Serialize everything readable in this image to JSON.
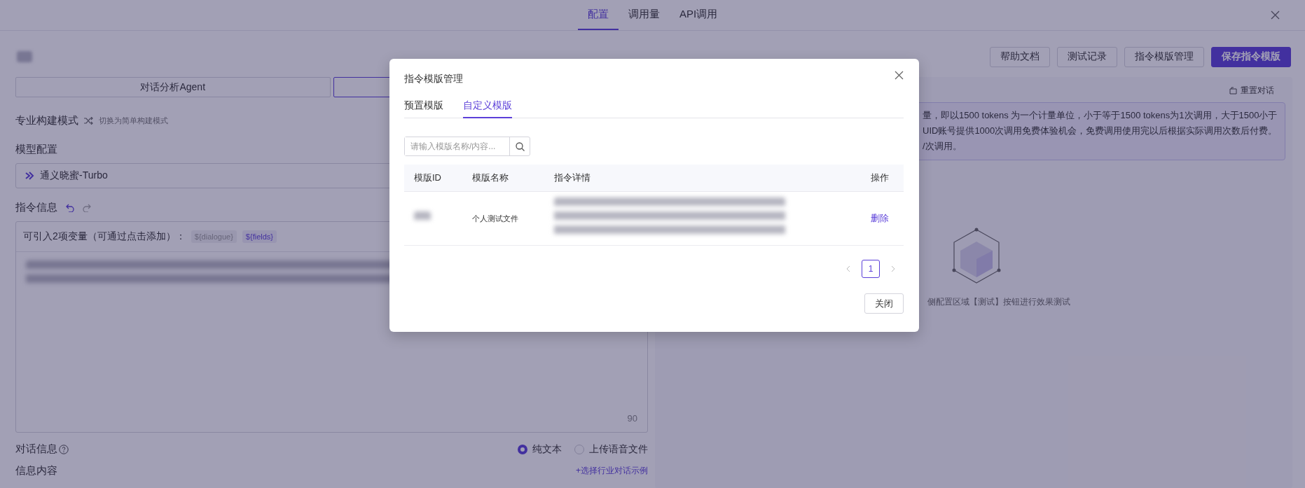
{
  "top_tabs": [
    {
      "label": "配置",
      "selected": true
    },
    {
      "label": "调用量",
      "selected": false
    },
    {
      "label": "API调用",
      "selected": false
    }
  ],
  "toolbar_buttons": [
    {
      "label": "帮助文档",
      "kind": "default"
    },
    {
      "label": "测试记录",
      "kind": "default"
    },
    {
      "label": "指令模版管理",
      "kind": "default"
    },
    {
      "label": "保存指令模版",
      "kind": "primary"
    }
  ],
  "agent_tabs": [
    {
      "label": "对话分析Agent",
      "selected": false
    },
    {
      "selected": true
    }
  ],
  "build_mode": {
    "label": "专业构建模式",
    "switch_link": "切换为简单构建模式"
  },
  "model_config": {
    "label": "模型配置",
    "value": "通义晓蜜-Turbo"
  },
  "instruction": {
    "label": "指令信息",
    "variables_hint": "可引入2项变量（可通过点击添加）：",
    "variables": [
      {
        "label": "${dialogue}",
        "disabled": true
      },
      {
        "label": "${fields}",
        "disabled": false
      }
    ],
    "char_count": "90"
  },
  "dialogue_info": {
    "label": "对话信息",
    "input_types": [
      {
        "label": "纯文本",
        "selected": true
      },
      {
        "label": "上传语音文件",
        "selected": false
      }
    ]
  },
  "message_content": {
    "label": "信息内容",
    "example_link": "+选择行业对话示例"
  },
  "preview": {
    "reset_button": "重置对话",
    "notice_lines": [
      "量，即以1500 tokens 为一个计量单位，小于等于1500 tokens为1次调用，大于1500小于",
      "UID账号提供1000次调用免费体验机会，免费调用使用完以后根据实际调用次数后付费。",
      "/次调用。"
    ],
    "empty_text": "侧配置区域【测试】按钮进行效果测试"
  },
  "modal": {
    "title": "指令模版管理",
    "tabs": [
      {
        "label": "预置模版",
        "selected": false
      },
      {
        "label": "自定义模版",
        "selected": true
      }
    ],
    "search": {
      "placeholder": "请输入模版名称/内容..."
    },
    "table": {
      "columns": [
        "模版ID",
        "模版名称",
        "指令详情",
        "操作"
      ],
      "rows": [
        {
          "name": "个人测试文件",
          "action": "删除"
        }
      ]
    },
    "pagination": [
      {
        "label": "1",
        "selected": true
      }
    ],
    "close_button": "关闭"
  }
}
